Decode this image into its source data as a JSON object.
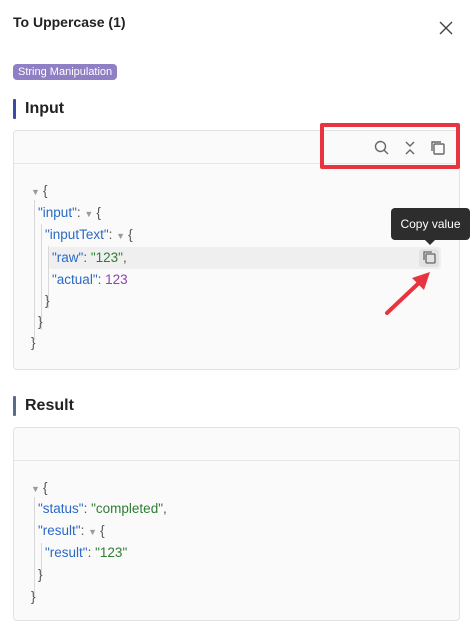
{
  "header": {
    "title": "To Uppercase (1)"
  },
  "tag": {
    "label": "String Manipulation"
  },
  "input_section": {
    "title": "Input",
    "toolbar_icons": [
      "search-icon",
      "collapse-icon",
      "copy-icon"
    ],
    "json": {
      "open": "{",
      "input_key": "\"input\"",
      "inputText_key": "\"inputText\"",
      "raw_key": "\"raw\"",
      "raw_value": "\"123\"",
      "actual_key": "\"actual\"",
      "actual_value": "123",
      "close": "}"
    },
    "tooltip": "Copy value"
  },
  "result_section": {
    "title": "Result",
    "json": {
      "open": "{",
      "status_key": "\"status\"",
      "status_value": "\"completed\"",
      "result_key": "\"result\"",
      "inner_result_key": "\"result\"",
      "inner_result_value": "\"123\"",
      "close": "}"
    }
  },
  "colors": {
    "accent_input": "#3b4aa8",
    "accent_result": "#5b6b8c",
    "tag_bg": "#8f7fc4",
    "highlight": "#e8343f",
    "json_key": "#2b69c7",
    "json_string": "#2e7d32",
    "json_number": "#8e44ad"
  }
}
